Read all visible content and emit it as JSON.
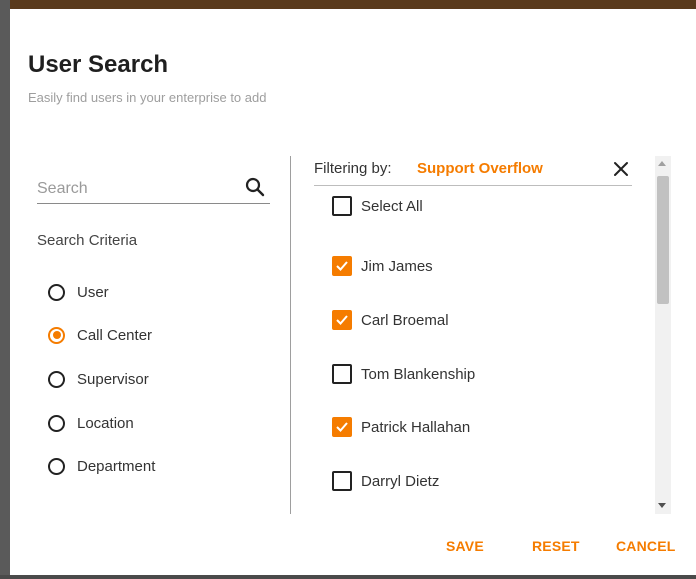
{
  "dialog": {
    "title": "User Search",
    "subtitle": "Easily find users in your enterprise to add"
  },
  "search": {
    "placeholder": "Search",
    "icon": "search-icon"
  },
  "criteria": {
    "label": "Search Criteria",
    "options": [
      {
        "label": "User",
        "selected": false
      },
      {
        "label": "Call Center",
        "selected": true
      },
      {
        "label": "Supervisor",
        "selected": false
      },
      {
        "label": "Location",
        "selected": false
      },
      {
        "label": "Department",
        "selected": false
      }
    ]
  },
  "filter": {
    "label": "Filtering by:",
    "value": "Support Overflow",
    "clear_icon": "close-icon"
  },
  "users": {
    "select_all": {
      "label": "Select All",
      "checked": false
    },
    "items": [
      {
        "label": "Jim James",
        "checked": true
      },
      {
        "label": "Carl Broemal",
        "checked": true
      },
      {
        "label": "Tom Blankenship",
        "checked": false
      },
      {
        "label": "Patrick Hallahan",
        "checked": true
      },
      {
        "label": "Darryl Dietz",
        "checked": false
      }
    ]
  },
  "actions": {
    "save": "SAVE",
    "reset": "RESET",
    "cancel": "CANCEL"
  },
  "colors": {
    "accent": "#f57c00",
    "text": "#212121",
    "muted": "#9e9e9e"
  }
}
